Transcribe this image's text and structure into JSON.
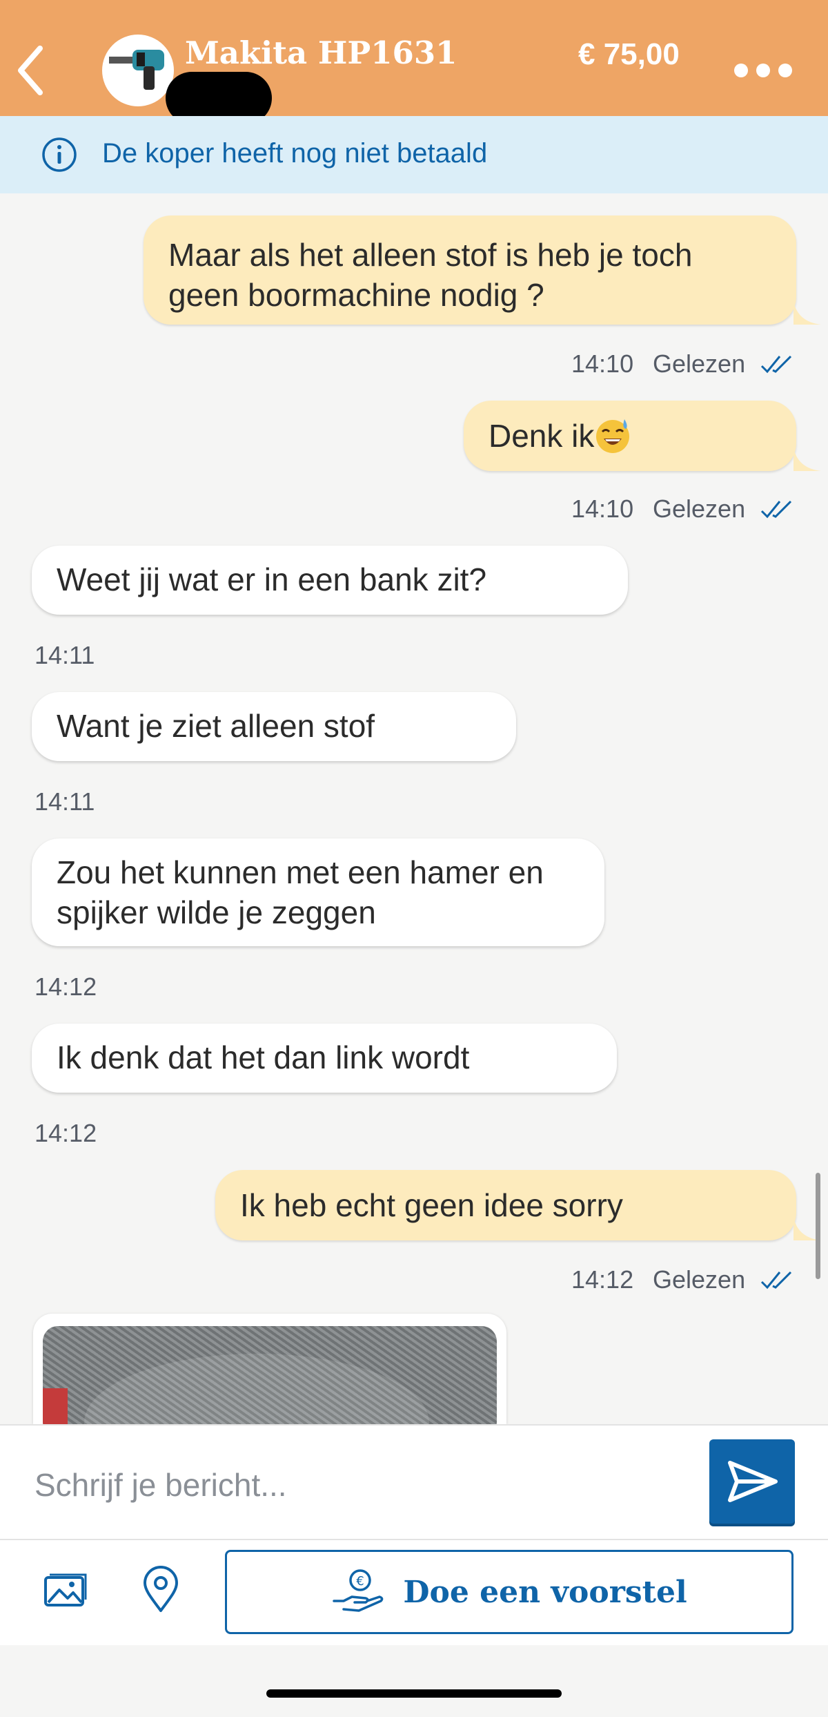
{
  "header": {
    "title": "Makita HP1631",
    "price": "€ 75,00",
    "back_icon": "chevron-left-icon",
    "more_icon": "more-dots-icon"
  },
  "banner": {
    "text": "De koper heeft nog niet betaald",
    "icon": "info-icon"
  },
  "messages": [
    {
      "direction": "out",
      "lines": [
        "Maar als het alleen stof is heb je toch",
        "geen boormachine nodig ?"
      ],
      "time": "14:10",
      "status": "Gelezen"
    },
    {
      "direction": "out",
      "text": "Denk ik",
      "emoji": "sweat-smile-emoji",
      "time": "14:10",
      "status": "Gelezen"
    },
    {
      "direction": "in",
      "text": "Weet jij wat er in een bank zit?",
      "time": "14:11"
    },
    {
      "direction": "in",
      "text": "Want je ziet alleen stof",
      "time": "14:11"
    },
    {
      "direction": "in",
      "lines": [
        "Zou het kunnen met een hamer en",
        "spijker wilde je zeggen"
      ],
      "time": "14:12"
    },
    {
      "direction": "in",
      "text": "Ik denk dat het dan link wordt",
      "time": "14:12"
    },
    {
      "direction": "out",
      "text": "Ik heb echt geen idee sorry",
      "time": "14:12",
      "status": "Gelezen"
    },
    {
      "direction": "in",
      "type": "image"
    }
  ],
  "composer": {
    "placeholder": "Schrijf je bericht...",
    "send_icon": "send-icon"
  },
  "toolbar": {
    "gallery_icon": "gallery-icon",
    "location_icon": "location-pin-icon",
    "offer_label": "Doe een voorstel",
    "offer_icon": "hand-euro-icon"
  },
  "colors": {
    "header": "#eea565",
    "accent": "#0f64a8",
    "outgoing_bubble": "#fdebbd",
    "banner": "#dbeef8"
  }
}
